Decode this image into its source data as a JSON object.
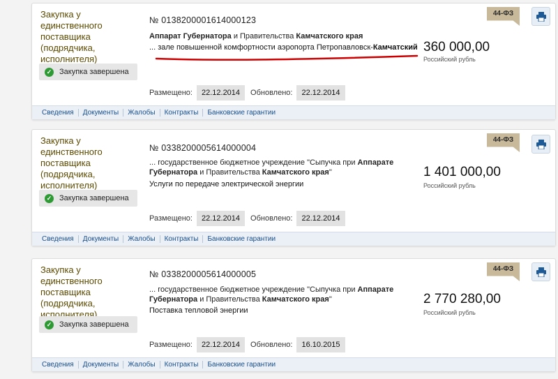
{
  "cards": [
    {
      "type_label": "Закупка у единственного поставщика (подрядчика, исполнителя)",
      "status": "Закупка завершена",
      "number": "№ 0138200001614000123",
      "desc_parts": [
        {
          "t": "Аппарат Губернатора",
          "b": true
        },
        {
          "t": " и Правительства ",
          "b": false
        },
        {
          "t": "Камчатского края",
          "b": true
        }
      ],
      "object_parts": [
        {
          "t": "... зале повышенной комфортности аэропорта Петропавловск-",
          "b": false
        },
        {
          "t": "Камчатский",
          "b": true
        }
      ],
      "price": "360 000,00",
      "currency": "Российский рубль",
      "law_badge": "44-ФЗ",
      "posted_label": "Размещено:",
      "posted": "22.12.2014",
      "updated_label": "Обновлено:",
      "updated": "22.12.2014",
      "tabs": [
        "Сведения",
        "Документы",
        "Жалобы",
        "Контракты",
        "Банковские гарантии"
      ]
    },
    {
      "type_label": "Закупка у единственного поставщика (подрядчика, исполнителя)",
      "status": "Закупка завершена",
      "number": "№ 0338200005614000004",
      "desc_parts": [
        {
          "t": "... государственное бюджетное учреждение \"Сыпучка при ",
          "b": false
        },
        {
          "t": "Аппарате Губернатора",
          "b": true
        },
        {
          "t": " и Правительства ",
          "b": false
        },
        {
          "t": "Камчатского края",
          "b": true
        },
        {
          "t": "\"",
          "b": false
        }
      ],
      "object_parts": [
        {
          "t": "Услуги по передаче электрической энергии",
          "b": false
        }
      ],
      "price": "1 401 000,00",
      "currency": "Российский рубль",
      "law_badge": "44-ФЗ",
      "posted_label": "Размещено:",
      "posted": "22.12.2014",
      "updated_label": "Обновлено:",
      "updated": "22.12.2014",
      "tabs": [
        "Сведения",
        "Документы",
        "Жалобы",
        "Контракты",
        "Банковские гарантии"
      ]
    },
    {
      "type_label": "Закупка у единственного поставщика (подрядчика, исполнителя)",
      "status": "Закупка завершена",
      "number": "№ 0338200005614000005",
      "desc_parts": [
        {
          "t": "... государственное бюджетное учреждение \"Сыпучка при ",
          "b": false
        },
        {
          "t": "Аппарате Губернатора",
          "b": true
        },
        {
          "t": " и Правительства ",
          "b": false
        },
        {
          "t": "Камчатского края",
          "b": true
        },
        {
          "t": "\"",
          "b": false
        }
      ],
      "object_parts": [
        {
          "t": "Поставка тепловой энергии",
          "b": false
        }
      ],
      "price": "2 770 280,00",
      "currency": "Российский рубль",
      "law_badge": "44-ФЗ",
      "posted_label": "Размещено:",
      "posted": "22.12.2014",
      "updated_label": "Обновлено:",
      "updated": "16.10.2015",
      "tabs": [
        "Сведения",
        "Документы",
        "Жалобы",
        "Контракты",
        "Банковские гарантии"
      ]
    }
  ],
  "colors": {
    "type_label": "#5c4a00",
    "badge": "#c8b99a",
    "tab_link": "#1a4f8c",
    "status_ok": "#2e9a34",
    "annotation_underline": "#cc0000"
  }
}
